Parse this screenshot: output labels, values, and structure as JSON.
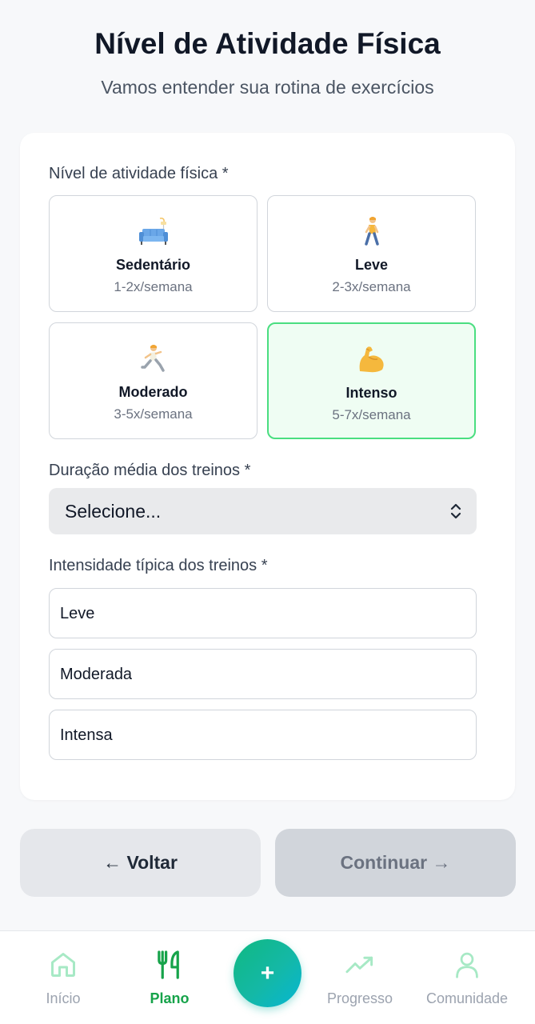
{
  "header": {
    "title": "Nível de Atividade Física",
    "subtitle": "Vamos entender sua rotina de exercícios"
  },
  "activity": {
    "label": "Nível de atividade física *",
    "options": [
      {
        "name": "Sedentário",
        "freq": "1-2x/semana",
        "icon": "couch-icon",
        "selected": false
      },
      {
        "name": "Leve",
        "freq": "2-3x/semana",
        "icon": "walking-person-icon",
        "selected": false
      },
      {
        "name": "Moderado",
        "freq": "3-5x/semana",
        "icon": "running-person-icon",
        "selected": false
      },
      {
        "name": "Intenso",
        "freq": "5-7x/semana",
        "icon": "flexed-biceps-icon",
        "selected": true
      }
    ]
  },
  "duration": {
    "label": "Duração média dos treinos *",
    "value": "Selecione..."
  },
  "intensity": {
    "label": "Intensidade típica dos treinos *",
    "options": [
      "Leve",
      "Moderada",
      "Intensa"
    ]
  },
  "buttons": {
    "back": "← Voltar",
    "continue": "Continuar →"
  },
  "nav": {
    "items": [
      {
        "label": "Início",
        "icon": "home-icon",
        "active": false
      },
      {
        "label": "Plano",
        "icon": "fork-knife-icon",
        "active": true
      },
      {
        "label": "Progresso",
        "icon": "trending-up-icon",
        "active": false
      },
      {
        "label": "Comunidade",
        "icon": "user-icon",
        "active": false
      }
    ],
    "fab_label": "+"
  },
  "colors": {
    "accent": "#16a34a",
    "selected_border": "#4ade80",
    "selected_bg": "#effdf3",
    "fab_gradient_start": "#10b981",
    "fab_gradient_end": "#06b6d4"
  }
}
